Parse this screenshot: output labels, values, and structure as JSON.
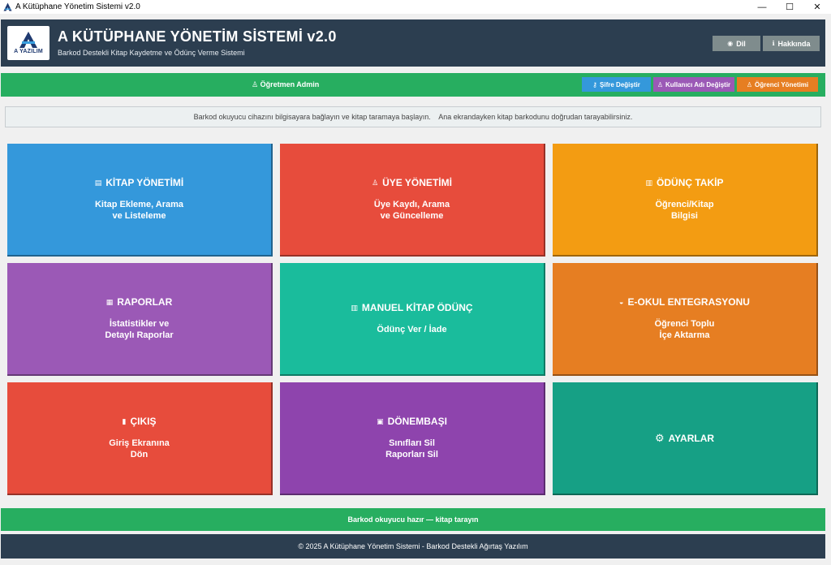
{
  "window": {
    "title": "A Kütüphane Yönetim Sistemi v2.0",
    "controls": {
      "minimize": "—",
      "maximize": "☐",
      "close": "✕"
    }
  },
  "header": {
    "logo_text": "A YAZILIM",
    "title": "A KÜTÜPHANE YÖNETİM SİSTEMİ v2.0",
    "subtitle": "Barkod Destekli Kitap Kaydetme ve Ödünç Verme Sistemi",
    "buttons": [
      {
        "icon": "globe-icon",
        "glyph": "◉",
        "label": "Dil"
      },
      {
        "icon": "info-icon",
        "glyph": "ℹ",
        "label": "Hakkında"
      }
    ]
  },
  "user_bar": {
    "user_glyph": "♙",
    "user_label": "Öğretmen Admin",
    "buttons": [
      {
        "icon": "key-icon",
        "glyph": "⚷",
        "label": "Şifre Değiştir",
        "color": "#3498db"
      },
      {
        "icon": "user-edit-icon",
        "glyph": "♙",
        "label": "Kullanıcı Adı Değiştir",
        "color": "#9b59b6"
      },
      {
        "icon": "students-icon",
        "glyph": "♙",
        "label": "Öğrenci Yönetimi",
        "color": "#e67e22"
      }
    ]
  },
  "info_text": "Barkod okuyucu cihazını bilgisayara bağlayın ve kitap taramaya başlayın.    Ana ekrandayken kitap barkodunu doğrudan tarayabilirsiniz.",
  "tiles": [
    {
      "icon": "books-icon",
      "glyph": "▤",
      "title": "KİTAP YÖNETİMİ",
      "desc": "Kitap Ekleme, Arama\nve Listeleme",
      "color": "#3498db"
    },
    {
      "icon": "members-icon",
      "glyph": "♙",
      "title": "ÜYE YÖNETİMİ",
      "desc": "Üye Kaydı, Arama\nve Güncelleme",
      "color": "#e74c3c"
    },
    {
      "icon": "loan-icon",
      "glyph": "▥",
      "title": "ÖDÜNÇ TAKİP",
      "desc": "Öğrenci/Kitap\nBilgisi",
      "color": "#f39c12"
    },
    {
      "icon": "reports-icon",
      "glyph": "▦",
      "title": "RAPORLAR",
      "desc": "İstatistikler ve\nDetaylı Raporlar",
      "color": "#9b59b6"
    },
    {
      "icon": "manual-loan-icon",
      "glyph": "▥",
      "title": "MANUEL KİTAP ÖDÜNÇ",
      "desc": "Ödünç Ver / İade",
      "color": "#1abc9c"
    },
    {
      "icon": "graduation-cap-icon",
      "glyph": "◒",
      "title": "E-OKUL ENTEGRASYONU",
      "desc": "Öğrenci Toplu\nİçe Aktarma",
      "color": "#e67e22"
    },
    {
      "icon": "exit-icon",
      "glyph": "▮",
      "title": "ÇIKIŞ",
      "desc": "Giriş Ekranına\nDön",
      "color": "#e74c3c"
    },
    {
      "icon": "calendar-reset-icon",
      "glyph": "▣",
      "title": "DÖNEMBAŞI",
      "desc": "Sınıfları Sil\nRaporları Sil",
      "color": "#8e44ad"
    },
    {
      "icon": "gear-icon",
      "glyph": "⚙",
      "title": "AYARLAR",
      "desc": "",
      "color": "#16a085"
    }
  ],
  "status_text": "Barkod okuyucu hazır — kitap tarayın",
  "footer_text": "© 2025 A Kütüphane Yönetim Sistemi - Barkod Destekli Ağırtaş Yazılım"
}
